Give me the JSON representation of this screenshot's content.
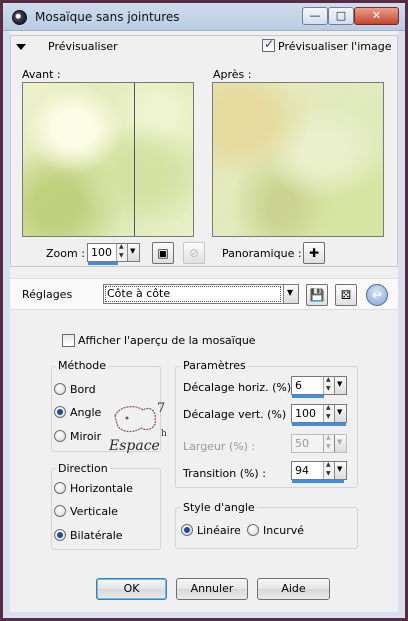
{
  "window": {
    "title": "Mosaïque sans jointures"
  },
  "preview": {
    "toggle_label": "Prévisualiser",
    "preview_image_label": "Prévisualiser l'image",
    "preview_image_checked": true,
    "before_label": "Avant :",
    "after_label": "Après :"
  },
  "zoom": {
    "label": "Zoom :",
    "value": "100",
    "pan_label": "Panoramique :"
  },
  "settings": {
    "label": "Réglages",
    "preset": "Côte à côte"
  },
  "mosaic_preview": {
    "label": "Afficher l'aperçu de la mosaïque",
    "checked": false
  },
  "method": {
    "title": "Méthode",
    "options": [
      "Bord",
      "Angle",
      "Miroir"
    ],
    "selected": "Angle"
  },
  "direction": {
    "title": "Direction",
    "options": [
      "Horizontale",
      "Verticale",
      "Bilatérale"
    ],
    "selected": "Bilatérale"
  },
  "params": {
    "title": "Paramètres",
    "fields": [
      {
        "label": "Décalage horiz. (%) :",
        "value": "6",
        "disabled": false,
        "fill": 0.06
      },
      {
        "label": "Décalage vert. (%) :",
        "value": "100",
        "disabled": false,
        "fill": 1.0
      },
      {
        "label": "Largeur (%) :",
        "value": "50",
        "disabled": true,
        "fill": 0.5
      },
      {
        "label": "Transition (%) :",
        "value": "94",
        "disabled": false,
        "fill": 0.94
      }
    ]
  },
  "corner_style": {
    "title": "Style d'angle",
    "options": [
      "Linéaire",
      "Incurvé"
    ],
    "selected": "Linéaire"
  },
  "watermark": {
    "text_top": "7",
    "text_side": "h",
    "text_bottom": "Espace"
  },
  "buttons": {
    "ok": "OK",
    "cancel": "Annuler",
    "help": "Aide"
  },
  "icons": {
    "app": "app-icon",
    "minimize": "minimize-icon",
    "maximize": "maximize-icon",
    "close": "close-icon",
    "fit": "fit-window-icon",
    "no_zoom": "no-zoom-icon",
    "pan": "pan-icon",
    "save": "save-icon",
    "random": "dice-icon",
    "reset": "reset-icon"
  },
  "colors": {
    "accent": "#3d8ee6",
    "frame": "#5a2c44",
    "selected_radio": "#1d4aa5"
  }
}
